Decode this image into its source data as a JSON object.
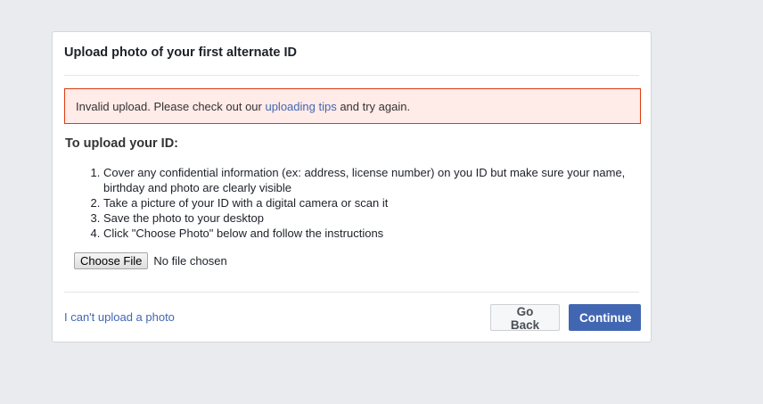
{
  "dialog": {
    "title": "Upload photo of your first alternate ID"
  },
  "error": {
    "prefix": "Invalid upload. Please check out our ",
    "link_text": "uploading tips",
    "suffix": " and try again.",
    "border_color": "#dd3c10",
    "background_color": "#ffebe8"
  },
  "instructions": {
    "heading": "To upload your ID:",
    "steps": [
      "Cover any confidential information (ex: address, license number) on you ID but make sure your name, birthday and photo are clearly visible",
      "Take a picture of your ID with a digital camera or scan it",
      "Save the photo to your desktop",
      "Click \"Choose Photo\" below and follow the instructions"
    ]
  },
  "file_input": {
    "button_label": "Choose File",
    "status": "No file chosen"
  },
  "footer": {
    "cant_upload_link": "I can't upload a photo",
    "go_back_label": "Go Back",
    "continue_label": "Continue",
    "accent_color": "#4267b2"
  }
}
